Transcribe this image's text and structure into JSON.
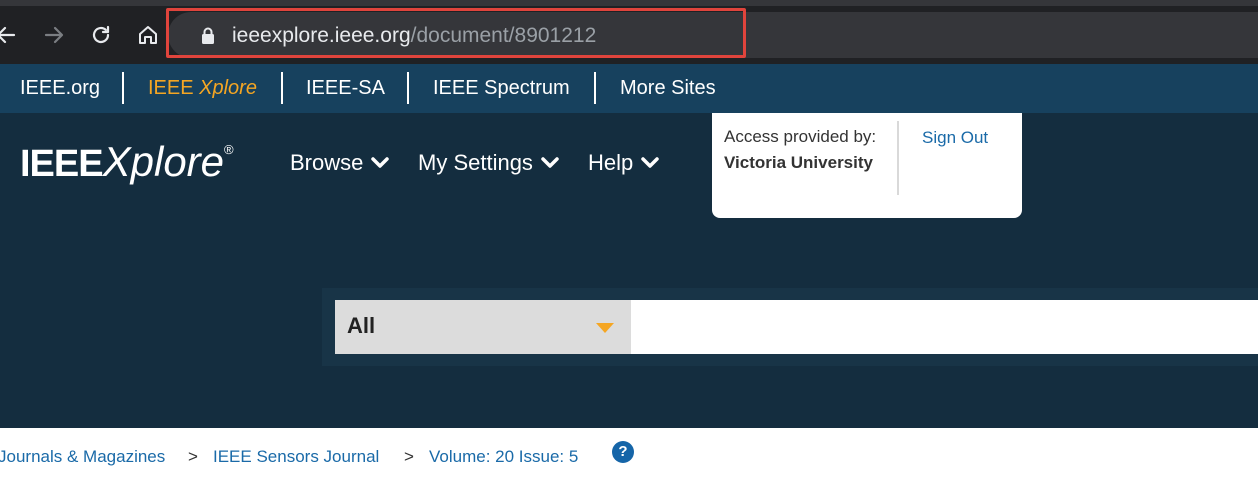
{
  "browser": {
    "url_host": "ieeexplore.ieee.org",
    "url_path": "/document/8901212",
    "icons": [
      "back-arrow-icon",
      "forward-arrow-icon",
      "reload-icon",
      "home-icon",
      "lock-icon"
    ]
  },
  "sites_bar": {
    "items": [
      {
        "label": "IEEE.org"
      },
      {
        "label_prefix": "IEEE",
        "label_emph": "Xplore"
      },
      {
        "label": "IEEE-SA"
      },
      {
        "label": "IEEE Spectrum"
      },
      {
        "label": "More Sites"
      }
    ],
    "active_color": "#f5a623"
  },
  "header": {
    "logo_ieee": "IEEE",
    "logo_xplore": "Xplore",
    "logo_reg": "®",
    "menu": [
      {
        "label": "Browse"
      },
      {
        "label": "My Settings"
      },
      {
        "label": "Help"
      }
    ]
  },
  "access": {
    "label": "Access provided by:",
    "institution": "Victoria University",
    "sign_out": "Sign Out"
  },
  "search": {
    "selected_scope": "All",
    "query": ""
  },
  "breadcrumb": {
    "items": [
      {
        "label": "Journals & Magazines"
      },
      {
        "label": "IEEE Sensors Journal"
      },
      {
        "label": "Volume: 20 Issue: 5"
      }
    ],
    "separator": ">",
    "help": "?"
  },
  "colors": {
    "highlight_box": "#e0443c",
    "header_bg": "#142d3f",
    "sites_bar_bg": "#17415e",
    "link_blue": "#1a6aa8"
  }
}
